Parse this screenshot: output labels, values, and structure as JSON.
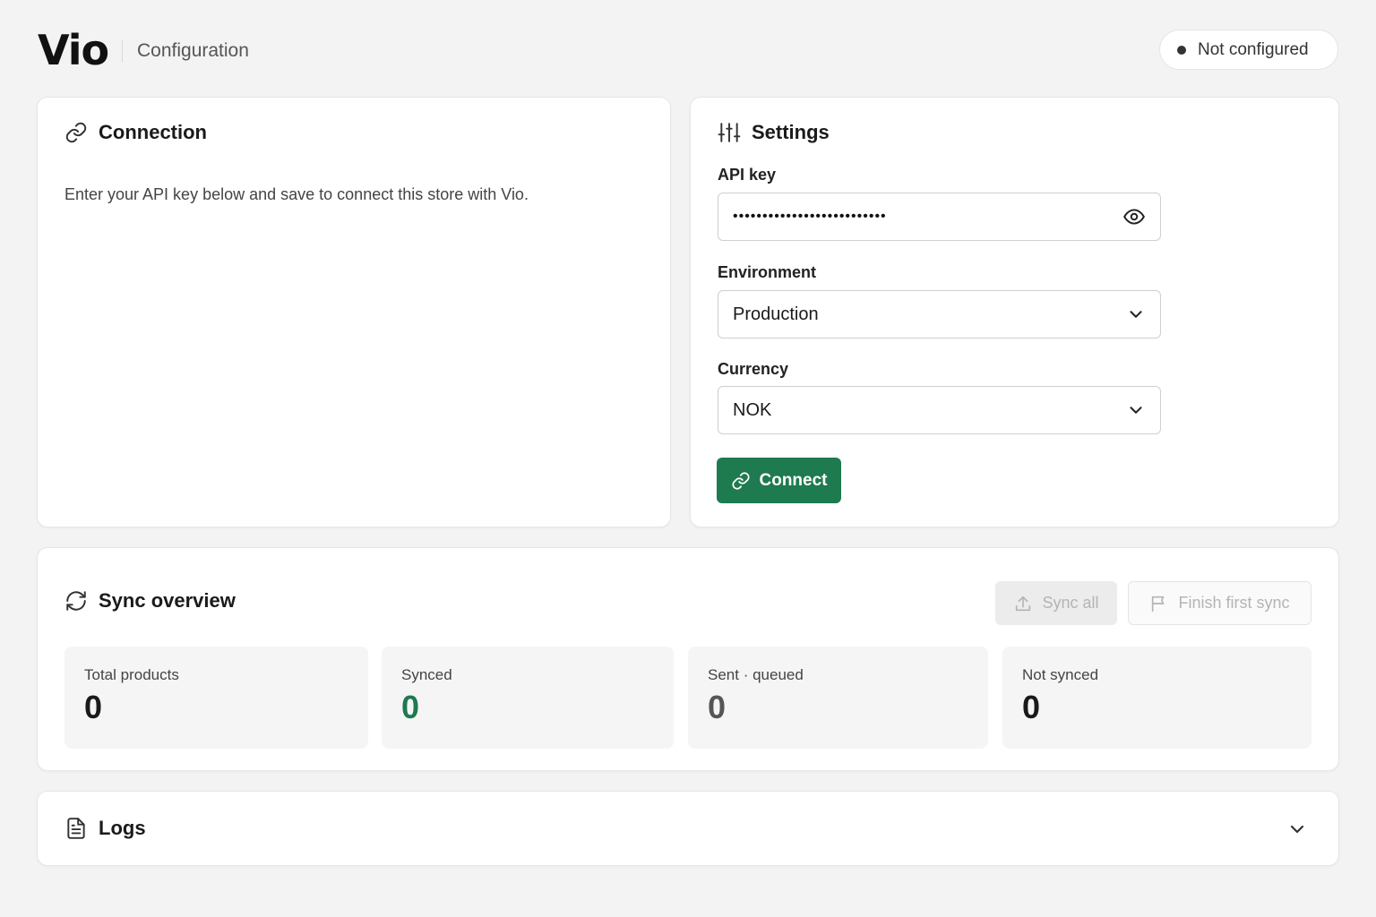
{
  "header": {
    "logo": "Vio",
    "subtitle": "Configuration",
    "status": "Not configured"
  },
  "connection": {
    "title": "Connection",
    "description": "Enter your API key below and save to connect this store with Vio."
  },
  "settings": {
    "title": "Settings",
    "api_key_label": "API key",
    "api_key_value": "••••••••••••••••••••••••••",
    "environment_label": "Environment",
    "environment_value": "Production",
    "currency_label": "Currency",
    "currency_value": "NOK",
    "connect_label": "Connect"
  },
  "sync": {
    "title": "Sync overview",
    "sync_all_label": "Sync all",
    "finish_label": "Finish first sync",
    "stats": [
      {
        "label": "Total products",
        "value": "0"
      },
      {
        "label": "Synced",
        "value": "0"
      },
      {
        "label": "Sent · queued",
        "value": "0"
      },
      {
        "label": "Not synced",
        "value": "0"
      }
    ]
  },
  "logs": {
    "title": "Logs"
  },
  "colors": {
    "accent": "#1e7a4f",
    "background": "#f3f3f3",
    "card": "#ffffff"
  }
}
